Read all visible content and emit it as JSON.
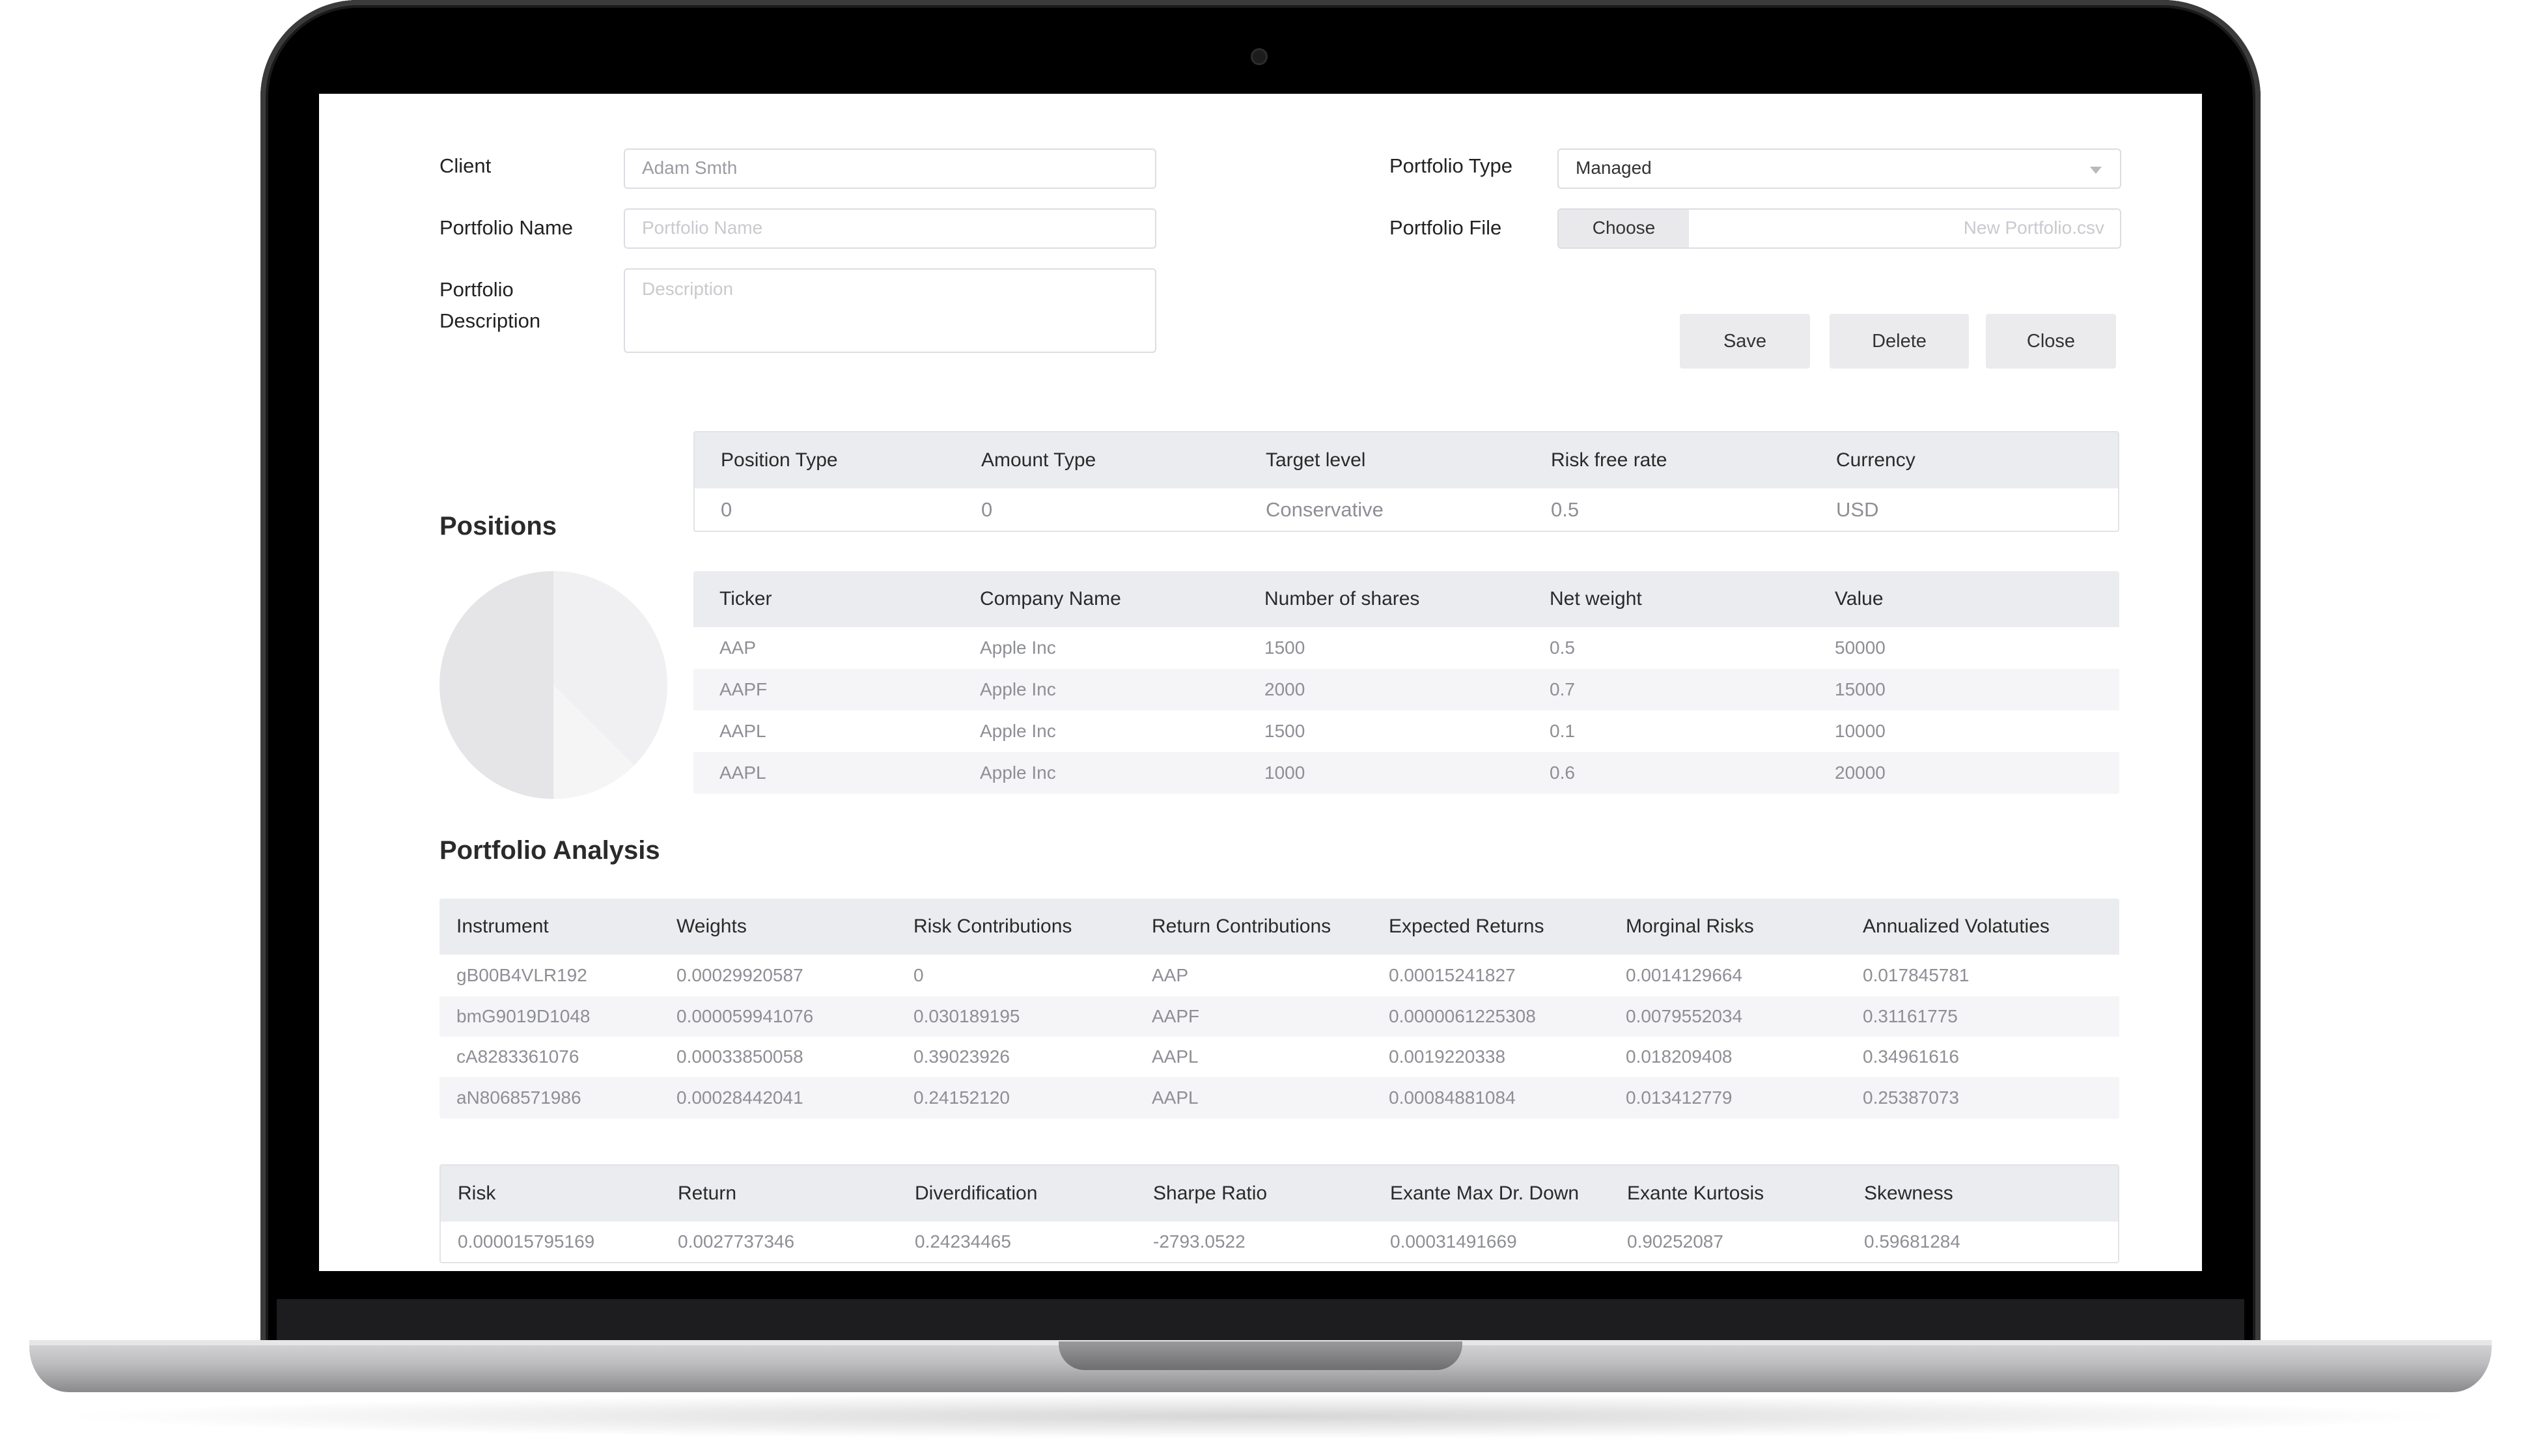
{
  "form": {
    "client_label": "Client",
    "client_value": "Adam Smth",
    "portfolio_name_label": "Portfolio Name",
    "portfolio_name_placeholder": "Portfolio Name",
    "portfolio_description_label_line1": "Portfolio",
    "portfolio_description_label_line2": "Description",
    "portfolio_description_placeholder": "Description",
    "portfolio_type_label": "Portfolio Type",
    "portfolio_type_value": "Managed",
    "portfolio_file_label": "Portfolio File",
    "choose_label": "Choose",
    "file_name": "New Portfolio.csv"
  },
  "actions": {
    "save": "Save",
    "delete": "Delete",
    "close": "Close"
  },
  "positions": {
    "title": "Positions",
    "settings": {
      "headers": [
        "Position Type",
        "Amount Type",
        "Target level",
        "Risk free rate",
        "Currency"
      ],
      "values": [
        "0",
        "0",
        "Conservative",
        "0.5",
        "USD"
      ]
    },
    "holdings": {
      "headers": [
        "Ticker",
        "Company Name",
        "Number of shares",
        "Net weight",
        "Value"
      ],
      "rows": [
        [
          "AAP",
          "Apple Inc",
          "1500",
          "0.5",
          "50000"
        ],
        [
          "AAPF",
          "Apple Inc",
          "2000",
          "0.7",
          "15000"
        ],
        [
          "AAPL",
          "Apple Inc",
          "1500",
          "0.1",
          "10000"
        ],
        [
          "AAPL",
          "Apple Inc",
          "1000",
          "0.6",
          "20000"
        ]
      ]
    }
  },
  "chart_data": {
    "type": "pie",
    "title": "",
    "slices": [
      {
        "value": 0.5,
        "color": "#e5e5e8"
      },
      {
        "value": 0.375,
        "color": "#f0f0f2"
      },
      {
        "value": 0.125,
        "color": "#f5f5f6"
      }
    ]
  },
  "analysis": {
    "title": "Portfolio Analysis",
    "headers": [
      "Instrument",
      "Weights",
      "Risk Contributions",
      "Return Contributions",
      "Expected Returns",
      "Morginal Risks",
      "Annualized Volatuties"
    ],
    "rows": [
      [
        "gB00B4VLR192",
        "0.00029920587",
        "0",
        "AAP",
        "0.00015241827",
        "0.0014129664",
        "0.017845781"
      ],
      [
        "bmG9019D1048",
        "0.000059941076",
        "0.030189195",
        "AAPF",
        "0.0000061225308",
        "0.0079552034",
        "0.31161775"
      ],
      [
        "cA8283361076",
        "0.00033850058",
        "0.39023926",
        "AAPL",
        "0.0019220338",
        "0.018209408",
        "0.34961616"
      ],
      [
        "aN8068571986",
        "0.00028442041",
        "0.24152120",
        "AAPL",
        "0.00084881084",
        "0.013412779",
        "0.25387073"
      ]
    ]
  },
  "summary": {
    "headers": [
      "Risk",
      "Return",
      "Diverdification",
      "Sharpe Ratio",
      "Exante Max Dr. Down",
      "Exante Kurtosis",
      "Skewness"
    ],
    "values": [
      "0.000015795169",
      "0.0027737346",
      "0.24234465",
      "-2793.0522",
      "0.00031491669",
      "0.90252087",
      "0.59681284"
    ]
  }
}
